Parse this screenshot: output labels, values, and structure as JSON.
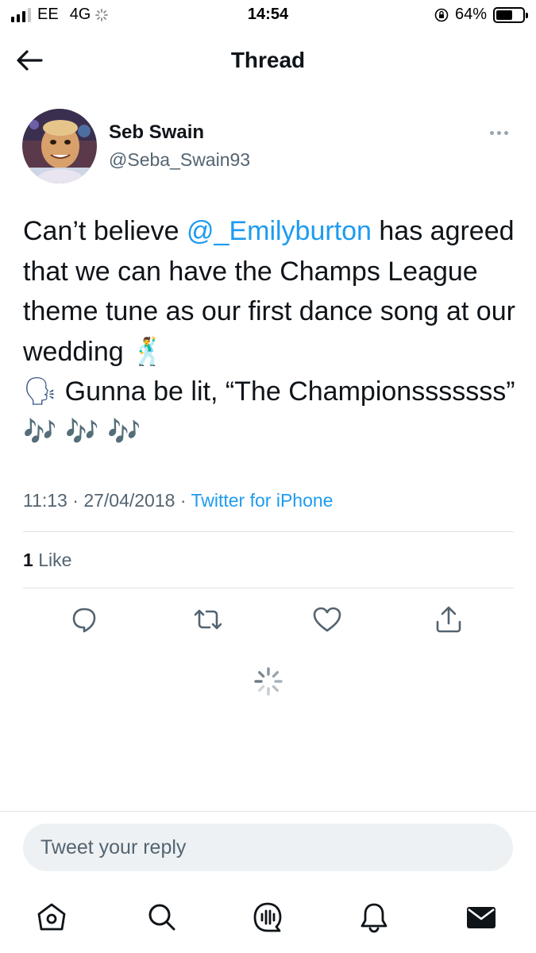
{
  "status_bar": {
    "carrier": "EE",
    "network": "4G",
    "time": "14:54",
    "battery_percent": "64%",
    "battery_level": 0.64
  },
  "header": {
    "title": "Thread"
  },
  "tweet": {
    "display_name": "Seb Swain",
    "handle": "@Seba_Swain93",
    "text_before_mention": "Can’t believe ",
    "mention": "@_Emilyburton",
    "text_after_mention": " has agreed that we can have the Champs League theme tune as our first dance song at our wedding ",
    "emoji_dancer": "🕺",
    "emoji_speaking": "🗣",
    "text_end": " Gunna be lit, “The Championsssssss” ",
    "emoji_notes": "🎶 🎶 🎶",
    "time": "11:13",
    "separator": "·",
    "date": "27/04/2018",
    "source": "Twitter for iPhone",
    "like_count": "1",
    "like_label": "Like"
  },
  "reply": {
    "placeholder": "Tweet your reply"
  },
  "icons": {
    "back": "arrow-left-icon",
    "more": "more-horizontal-icon",
    "reply": "comment-icon",
    "retweet": "retweet-icon",
    "like": "heart-icon",
    "share": "share-icon",
    "loading": "spinner-icon",
    "home": "home-icon",
    "search": "search-icon",
    "spaces": "spaces-icon",
    "notifications": "bell-icon",
    "messages": "envelope-icon"
  },
  "colors": {
    "accent": "#1d9bf0",
    "secondary_text": "#536471",
    "divider": "#dfe3e6"
  }
}
